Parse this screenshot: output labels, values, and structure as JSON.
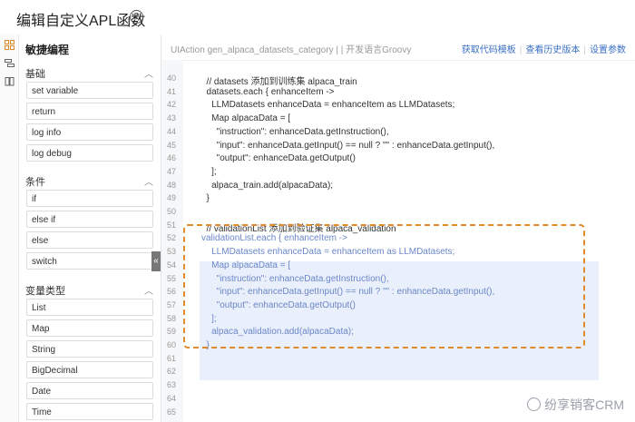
{
  "header": {
    "title": "编辑自定义APL函数",
    "help_icon": "question-circle-icon"
  },
  "rail": {
    "icons": [
      "grid-icon",
      "layers-icon",
      "book-icon"
    ]
  },
  "sidebar": {
    "title": "敏捷编程",
    "groups": [
      {
        "label": "基础",
        "items": [
          "set variable",
          "return",
          "log info",
          "log debug"
        ]
      },
      {
        "label": "条件",
        "items": [
          "if",
          "else if",
          "else",
          "switch"
        ]
      },
      {
        "label": "变量类型",
        "items": [
          "List",
          "Map",
          "String",
          "BigDecimal",
          "Date",
          "Time"
        ]
      }
    ],
    "collapse_glyph": "«"
  },
  "editor": {
    "subtitle": "UIAction gen_alpaca_datasets_category | | 开发语言Groovy",
    "links": [
      "获取代码模板",
      "查看历史版本",
      "设置参数"
    ],
    "lines": [
      {
        "n": "40",
        "t": "  // datasets 添加到训练集 alpaca_train",
        "sel": false
      },
      {
        "n": "41",
        "t": "  datasets.each { enhanceItem ->",
        "sel": false
      },
      {
        "n": "42",
        "t": "    LLMDatasets enhanceData = enhanceItem as LLMDatasets;",
        "sel": false
      },
      {
        "n": "43",
        "t": "    Map alpacaData = [",
        "sel": false
      },
      {
        "n": "44",
        "t": "      \"instruction\": enhanceData.getInstruction(),",
        "sel": false
      },
      {
        "n": "45",
        "t": "      \"input\": enhanceData.getInput() == null ? \"\" : enhanceData.getInput(),",
        "sel": false
      },
      {
        "n": "46",
        "t": "      \"output\": enhanceData.getOutput()",
        "sel": false
      },
      {
        "n": "47",
        "t": "    ];",
        "sel": false
      },
      {
        "n": "48",
        "t": "    alpaca_train.add(alpacaData);",
        "sel": false
      },
      {
        "n": "49",
        "t": "  }",
        "sel": false
      },
      {
        "n": "50",
        "t": "",
        "sel": false
      },
      {
        "n": "51",
        "t": "  // validationList 添加到验证集 alpaca_validation",
        "sel": false
      },
      {
        "n": "52",
        "t": "validationList.each { enhanceItem ->",
        "sel": true
      },
      {
        "n": "53",
        "t": "    LLMDatasets enhanceData = enhanceItem as LLMDatasets;",
        "sel": true
      },
      {
        "n": "54",
        "t": "    Map alpacaData = [",
        "sel": true
      },
      {
        "n": "55",
        "t": "      \"instruction\": enhanceData.getInstruction(),",
        "sel": true
      },
      {
        "n": "56",
        "t": "      \"input\": enhanceData.getInput() == null ? \"\" : enhanceData.getInput(),",
        "sel": true
      },
      {
        "n": "57",
        "t": "      \"output\": enhanceData.getOutput()",
        "sel": true
      },
      {
        "n": "58",
        "t": "    ];",
        "sel": true
      },
      {
        "n": "59",
        "t": "    alpaca_validation.add(alpacaData);",
        "sel": true
      },
      {
        "n": "60",
        "t": "  }",
        "sel": true
      },
      {
        "n": "61",
        "t": "",
        "sel": false
      },
      {
        "n": "62",
        "t": "",
        "sel": false
      },
      {
        "n": "63",
        "t": "",
        "sel": false
      },
      {
        "n": "64",
        "t": "",
        "sel": false
      },
      {
        "n": "65",
        "t": "",
        "sel": false
      }
    ]
  },
  "watermark": "纷享销客CRM"
}
